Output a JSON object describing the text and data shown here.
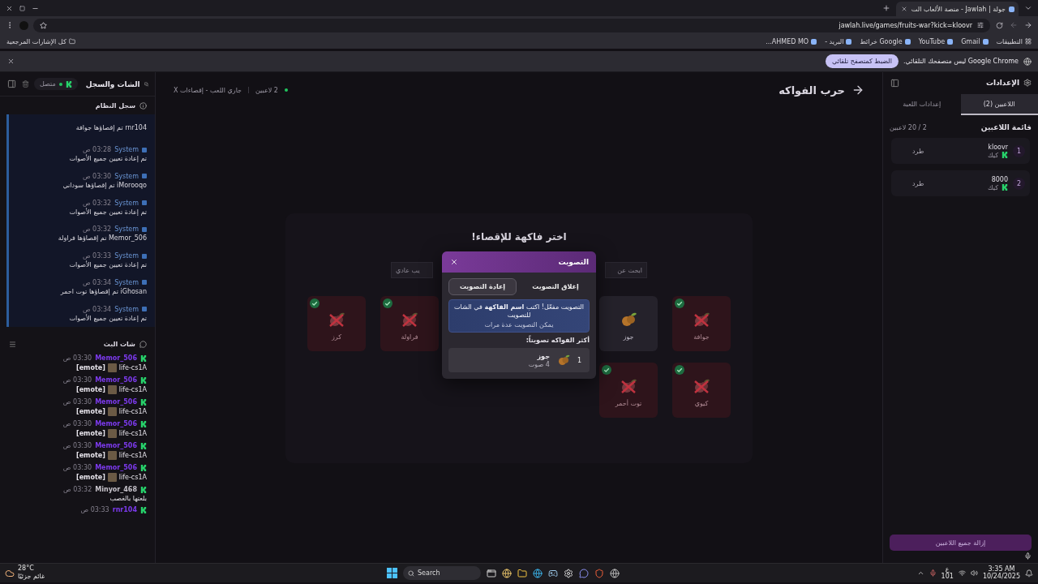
{
  "browser": {
    "tab_title": "جولة | Jawlah - منصة الألعاب الت",
    "url": "jawlah.live/games/fruits-war?kick=kloovr",
    "bookmarks": [
      "التطبيقات",
      "Gmail",
      "YouTube",
      "Google خرائط",
      "البريد -",
      "AHMED MO..."
    ],
    "all_bookmarks": "كل الإشارات المرجعية",
    "infobar": {
      "message": "Google Chrome ليس متصفحك التلقائي.",
      "button": "الضبط كمتصفح تلقائي"
    }
  },
  "chat_panel": {
    "title": "الشات والسجل",
    "status": "متصل",
    "log_title": "سجل النظام",
    "log": [
      {
        "message": "rnr104 تم إقصاؤها جوافة"
      },
      {
        "author": "System",
        "time": "03:28 ص",
        "message": "تم إعادة تعيين جميع الأصوات"
      },
      {
        "author": "System",
        "time": "03:30 ص",
        "message": "iMorooqo تم إقصاؤها سوداني"
      },
      {
        "author": "System",
        "time": "03:32 ص",
        "message": "تم إعادة تعيين جميع الأصوات"
      },
      {
        "author": "System",
        "time": "03:32 ص",
        "message": "Memor_506 تم إقصاؤها فراولة"
      },
      {
        "author": "System",
        "time": "03:33 ص",
        "message": "تم إعادة تعيين جميع الأصوات"
      },
      {
        "author": "System",
        "time": "03:34 ص",
        "message": "iGhosan تم إقصاؤها توت احمر"
      },
      {
        "author": "System",
        "time": "03:34 ص",
        "message": "تم إعادة تعيين جميع الأصوات"
      }
    ],
    "chat_title": "شات البث",
    "messages": [
      {
        "kind": "emote",
        "user": "Memor_506",
        "color": "#7c3aed",
        "time": "03:30 ص",
        "emote_name": "life-cs1A",
        "emote_tag": "[emote]"
      },
      {
        "kind": "emote",
        "user": "Memor_506",
        "color": "#7c3aed",
        "time": "03:30 ص",
        "emote_name": "life-cs1A",
        "emote_tag": "[emote]"
      },
      {
        "kind": "emote",
        "user": "Memor_506",
        "color": "#7c3aed",
        "time": "03:30 ص",
        "emote_name": "life-cs1A",
        "emote_tag": "[emote]"
      },
      {
        "kind": "emote",
        "user": "Memor_506",
        "color": "#7c3aed",
        "time": "03:30 ص",
        "emote_name": "life-cs1A",
        "emote_tag": "[emote]"
      },
      {
        "kind": "emote",
        "user": "Memor_506",
        "color": "#7c3aed",
        "time": "03:30 ص",
        "emote_name": "life-cs1A",
        "emote_tag": "[emote]"
      },
      {
        "kind": "emote",
        "user": "Memor_506",
        "color": "#7c3aed",
        "time": "03:30 ص",
        "emote_name": "life-cs1A",
        "emote_tag": "[emote]"
      },
      {
        "kind": "text",
        "user": "Minyor_468",
        "color": "#c8c4cc",
        "time": "03:32 ص",
        "text": "بلعتها بالغصب"
      },
      {
        "kind": "text",
        "user": "rnr104",
        "color": "#7c3aed",
        "time": "03:33 ص"
      }
    ]
  },
  "game": {
    "title": "حرب الفواكه",
    "players_badge": "2 لاعبين",
    "status": "جاري اللعب - إقصاءات X",
    "prompt": "اختر فاكهة للإقصاء!",
    "search_placeholder": "ابحث عن",
    "sort_value": "يب عادي",
    "fruits": [
      {
        "name": "جوافة",
        "eliminated": true
      },
      {
        "name": "جوز",
        "eliminated": false
      },
      {
        "name": "فراولة",
        "eliminated": true
      },
      {
        "name": "كرز",
        "eliminated": true
      },
      {
        "name": "كيوي",
        "eliminated": true
      },
      {
        "name": "توت أحمر",
        "eliminated": true
      }
    ]
  },
  "vote_dialog": {
    "title": "التصويت",
    "actions": [
      {
        "label": "إغلاق التصويت",
        "selected": false
      },
      {
        "label": "إعادة التصويت",
        "selected": true
      }
    ],
    "info": "التصويت مفعّل! اكتب **اسم الفاكهة** في الشات للتصويت",
    "note": "يمكن التصويت عدة مرات",
    "results_title": "أكثر الفواكه تصويتاً:",
    "results": [
      {
        "rank": "1",
        "name": "جوز",
        "votes": "4 صوت"
      }
    ]
  },
  "settings_panel": {
    "title": "الإعدادات",
    "tabs": [
      {
        "label": "اللاعبين (2)",
        "selected": true
      },
      {
        "label": "إعدادات اللعبة",
        "selected": false
      }
    ],
    "players_title": "قائمة اللاعبين",
    "players_count": "2 / 20 لاعبين",
    "players": [
      {
        "rank": "1",
        "name": "kloovr",
        "platform": "كيك",
        "action": "طرد"
      },
      {
        "rank": "2",
        "name": "8000",
        "platform": "كيك",
        "action": "طرد"
      }
    ],
    "remove_all_button": "إزالة جميع اللاعبين"
  },
  "taskbar": {
    "temperature": "28°C",
    "weather": "غائم جزئيًا",
    "search": "Search",
    "input_language": "ع",
    "keyboard_layout": "101",
    "time": "3:35 AM",
    "date": "10/24/2025"
  }
}
